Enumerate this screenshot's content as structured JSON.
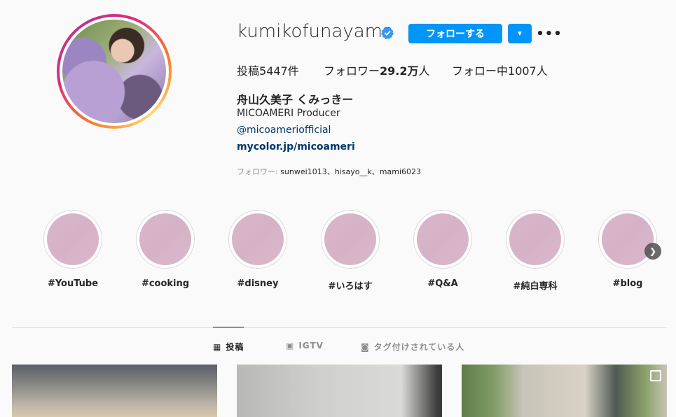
{
  "profile": {
    "username": "kumikofunayama",
    "follow_label": "フォローする",
    "posts_label": "投稿",
    "posts_count": "5447",
    "posts_unit": "件",
    "followers_label": "フォロワー",
    "followers_count": "29.2万",
    "followers_unit": "人",
    "following_label": "フォロー中",
    "following_count": "1007",
    "following_unit": "人",
    "full_name": "舟山久美子 くみっきー",
    "bio": "MICOAMERI Producer",
    "mention": "@micoameriofficial",
    "link": "mycolor.jp/micoameri",
    "followed_by_label": "フォロワー: ",
    "followed_by_names": "sunwei1013、hisayo__k、mami6023"
  },
  "highlights": [
    {
      "label": "#YouTube"
    },
    {
      "label": "#cooking"
    },
    {
      "label": "#disney"
    },
    {
      "label": "#いろはす"
    },
    {
      "label": "#Q&A"
    },
    {
      "label": "#純白専科"
    },
    {
      "label": "#blog"
    }
  ],
  "tabs": [
    {
      "label": "投稿",
      "icon": "grid-icon"
    },
    {
      "label": "IGTV",
      "icon": "igtv-icon"
    },
    {
      "label": "タグ付けされている人",
      "icon": "tagged-icon"
    }
  ],
  "colors": {
    "accent": "#0095f6",
    "link": "#00376b",
    "highlight_fill": "#d9b6cb"
  }
}
